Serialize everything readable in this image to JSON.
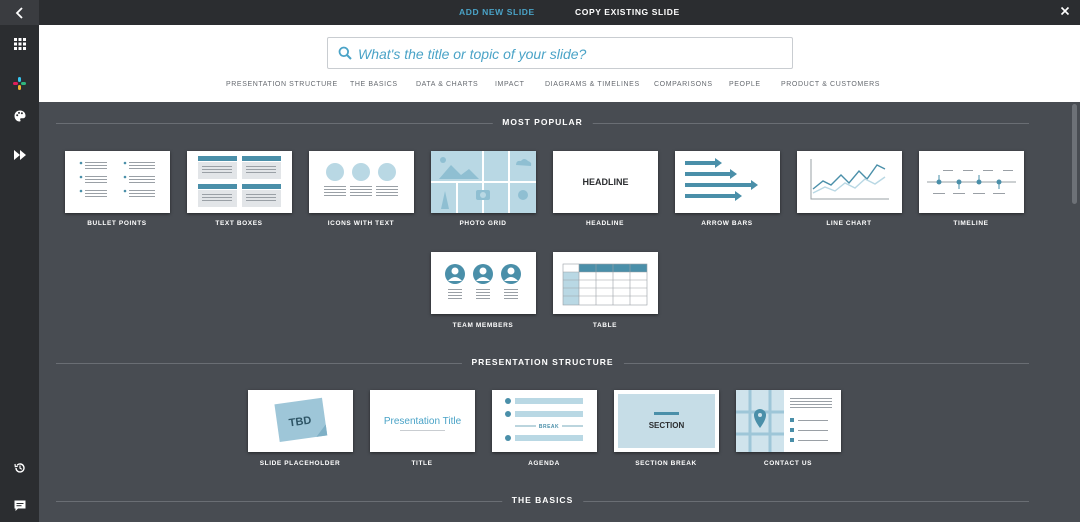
{
  "top_tabs": {
    "add_new": "ADD NEW SLIDE",
    "copy_existing": "COPY EXISTING SLIDE"
  },
  "search": {
    "placeholder": "What's the title or topic of your slide?"
  },
  "categories": [
    "PRESENTATION STRUCTURE",
    "THE BASICS",
    "DATA & CHARTS",
    "IMPACT",
    "DIAGRAMS & TIMELINES",
    "COMPARISONS",
    "PEOPLE",
    "PRODUCT & CUSTOMERS"
  ],
  "sections": {
    "most_popular": {
      "title": "MOST POPULAR",
      "items": [
        "BULLET POINTS",
        "TEXT BOXES",
        "ICONS WITH TEXT",
        "PHOTO GRID",
        "HEADLINE",
        "ARROW BARS",
        "LINE CHART",
        "TIMELINE",
        "TEAM MEMBERS",
        "TABLE"
      ]
    },
    "presentation_structure": {
      "title": "PRESENTATION STRUCTURE",
      "items": [
        "SLIDE PLACEHOLDER",
        "TITLE",
        "AGENDA",
        "SECTION BREAK",
        "CONTACT US"
      ]
    },
    "the_basics": {
      "title": "THE BASICS"
    }
  },
  "thumb_text": {
    "headline": "HEADLINE",
    "tbd": "TBD",
    "presentation_title": "Presentation Title",
    "break": "BREAK",
    "section": "SECTION"
  },
  "colors": {
    "accent": "#4aa3c7",
    "thumb_blue": "#4a8fa9",
    "thumb_light": "#b9d8e4",
    "background": "#484c52"
  }
}
